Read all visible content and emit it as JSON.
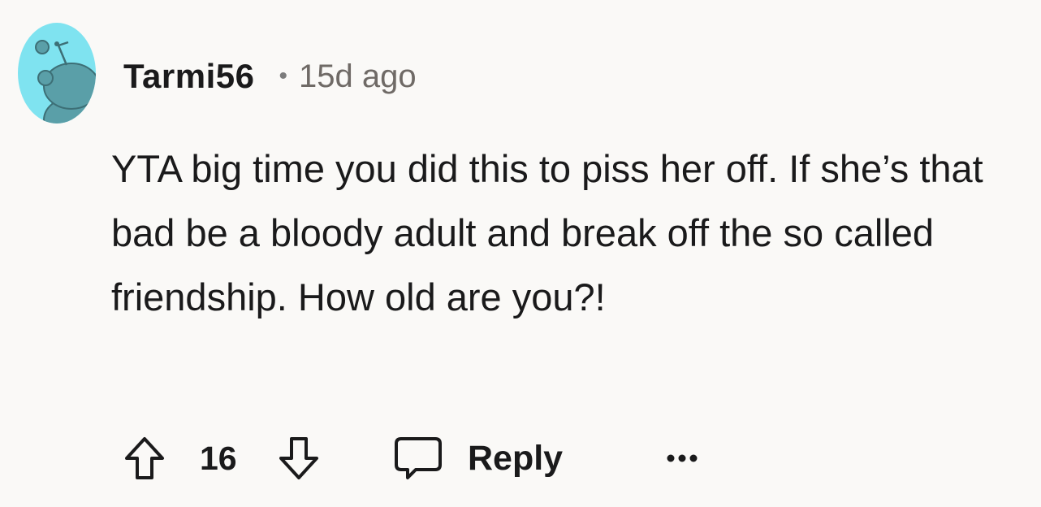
{
  "comment": {
    "author": "Tarmi56",
    "separator": "•",
    "time_ago": "15d ago",
    "body": "YTA big time you did this to piss her off. If she’s that bad be a bloody adult and break off the so called friendship. How old are you?!",
    "avatar_icon": "snoo-avatar-icon",
    "avatar_colors": {
      "background": "#7fe3f0",
      "figure": "#5a9fa8",
      "outline": "#3d6f76"
    }
  },
  "actions": {
    "upvote_icon": "arrow-up-icon",
    "score": "16",
    "downvote_icon": "arrow-down-icon",
    "reply_icon": "speech-bubble-icon",
    "reply_label": "Reply",
    "more_icon": "more-dots-icon"
  }
}
